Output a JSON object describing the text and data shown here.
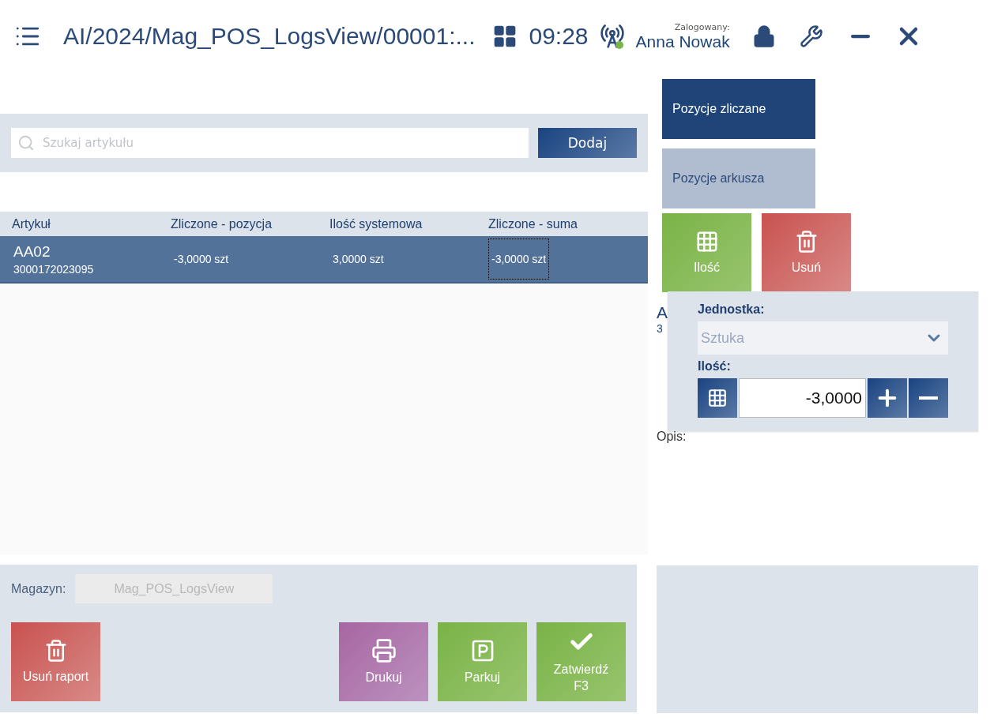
{
  "header": {
    "title": "AI/2024/Mag_POS_LogsView/00001:...",
    "time": "09:28",
    "logged_label": "Zalogowany:",
    "user": "Anna Nowak"
  },
  "search": {
    "placeholder": "Szukaj artykułu",
    "button": "Dodaj"
  },
  "table": {
    "columns": [
      "Artykuł",
      "Zliczone - pozycja",
      "Ilość systemowa",
      "Zliczone - suma"
    ],
    "rows": [
      {
        "selected": true,
        "cells": [
          {
            "text": "AA02",
            "code": "3000172023095",
            "focused": false
          },
          {
            "text": "-3,0000 szt",
            "focused": false
          },
          {
            "text": "3,0000 szt",
            "focused": false
          },
          {
            "text": "-3,0000 szt",
            "focused": true
          }
        ]
      }
    ]
  },
  "footer": {
    "warehouse_label": "Magazyn:",
    "warehouse": "Mag_POS_LogsView",
    "buttons": [
      {
        "kind": "delete",
        "label": "Usuń raport"
      },
      {
        "kind": "print",
        "label": "Drukuj"
      },
      {
        "kind": "park",
        "label": "Parkuj"
      },
      {
        "kind": "confirm",
        "label": "Zatwierdź",
        "shortcut": "F3"
      }
    ]
  },
  "side": {
    "tabs": [
      {
        "label": "Pozycje zliczane",
        "selected": true
      },
      {
        "label": "Pozycje arkusza",
        "selected": false
      }
    ],
    "actions": [
      {
        "kind": "quantity",
        "label": "Ilość"
      },
      {
        "kind": "delete",
        "label": "Usuń"
      }
    ],
    "detail_name": "A",
    "detail_code": "3",
    "description_label": "Opis:",
    "popup": {
      "unit_label": "Jednostka:",
      "unit": "Sztuka",
      "qty_label": "Ilość:",
      "qty": "-3,0000"
    }
  }
}
